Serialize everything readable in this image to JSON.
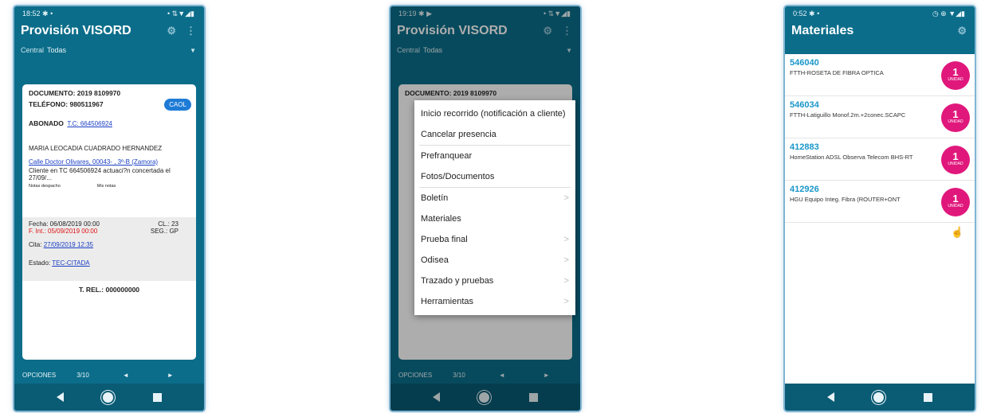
{
  "nav": {
    "back": "◀",
    "home": "●",
    "recents": "■"
  },
  "screen1": {
    "status": {
      "time": "18:52",
      "icons": "✱ •",
      "right": "• ⇅▼◢▮"
    },
    "title": "Provisión VISORD",
    "filter": {
      "label": "Central",
      "value": "Todas"
    },
    "card": {
      "documento": "DOCUMENTO: 2019 8109970",
      "telefono": "TELÉFONO: 980511967",
      "caol": "CAOL",
      "abonado_label": "ABONADO",
      "abonado_link": "T.C: 664506924",
      "name": "MARIA LEOCADIA CUADRADO HERNANDEZ",
      "address": "Calle  Doctor Olivares, 00043-  , 3º-B (Zamora)",
      "note": "Cliente  en TC 664506924 actuaci?n concertada el 27/09/...",
      "notas_despacho": "Notas despacho",
      "mis_notas": "Mis notas",
      "fecha": "Fecha: 06/08/2019 00:00",
      "cl": "CL.: 23",
      "f_int": "F. Int.: 05/09/2019 00:00",
      "seg": "SEG.: GP",
      "cita_label": "Cita:",
      "cita_value": "27/09/2019 12:35",
      "estado_label": "Estado:",
      "estado_value": "TEC-CITADA",
      "trel": "T. REL.: 000000000"
    },
    "bottom": {
      "opciones": "OPCIONES",
      "pager": "3/10",
      "prev": "◄",
      "next": "►"
    }
  },
  "screen2": {
    "status": {
      "time": "19:19",
      "icons": "✱ ▶",
      "right": "• ⇅▼◢▮"
    },
    "title": "Provisión VISORD",
    "filter": {
      "label": "Central",
      "value": "Todas"
    },
    "card_top": "DOCUMENTO: 2019 8109970",
    "menu": [
      {
        "label": "Inicio recorrido (notificación a cliente)",
        "sub": false
      },
      {
        "label": "Cancelar presencia",
        "sub": false
      },
      {
        "label": "Prefranquear",
        "sub": false
      },
      {
        "label": "Fotos/Documentos",
        "sub": false
      },
      {
        "label": "Boletín",
        "sub": true
      },
      {
        "label": "Materiales",
        "sub": false
      },
      {
        "label": "Prueba final",
        "sub": true
      },
      {
        "label": "Odisea",
        "sub": true
      },
      {
        "label": "Trazado y pruebas",
        "sub": true
      },
      {
        "label": "Herramientas",
        "sub": true
      }
    ],
    "bottom": {
      "opciones": "OPCIONES",
      "pager": "3/10",
      "prev": "◄",
      "next": "►"
    }
  },
  "screen3": {
    "status": {
      "time": "0:52",
      "icons": "✱ •",
      "right": "◷ ⊕ ▼◢▮"
    },
    "title": "Materiales",
    "items": [
      {
        "code": "546040",
        "desc": "FTTH-ROSETA DE FIBRA OPTICA",
        "qty": "1",
        "unit": "UNIDAD"
      },
      {
        "code": "546034",
        "desc": "FTTH-Latiguillo Monof.2m.+2conec.SCAPC",
        "qty": "1",
        "unit": "UNIDAD"
      },
      {
        "code": "412883",
        "desc": "HomeStation ADSL Observa Telecom BHS-RT",
        "qty": "1",
        "unit": "UNIDAD"
      },
      {
        "code": "412926",
        "desc": "HGU Equipo Integ. Fibra (ROUTER+ONT",
        "qty": "1",
        "unit": "UNIDAD"
      }
    ]
  }
}
